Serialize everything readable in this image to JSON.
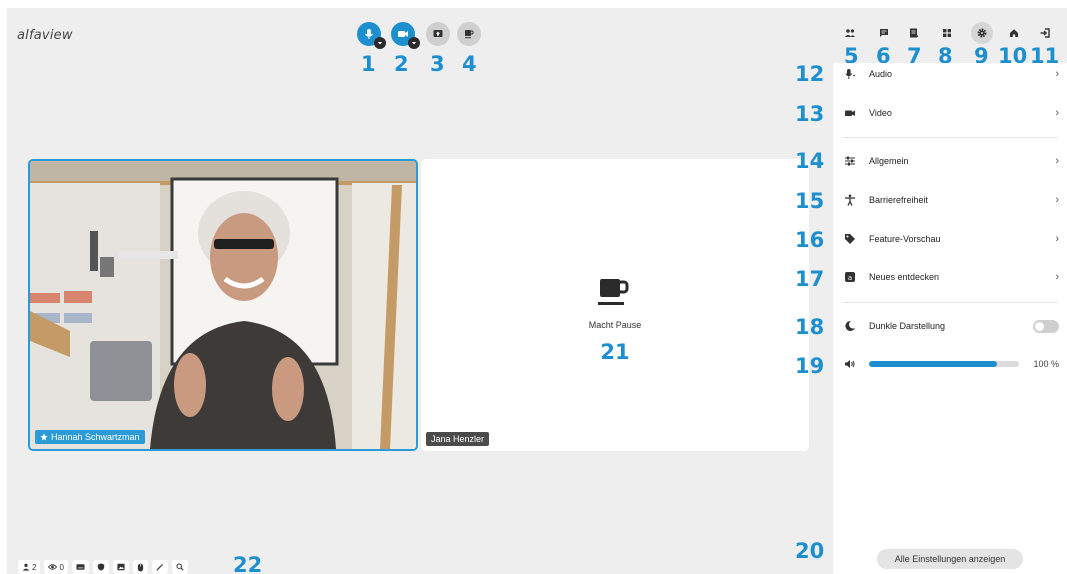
{
  "app": {
    "logo": "alfaview"
  },
  "controls": [
    {
      "id": "mic",
      "label": "1"
    },
    {
      "id": "camera",
      "label": "2"
    },
    {
      "id": "share",
      "label": "3"
    },
    {
      "id": "pause",
      "label": "4"
    }
  ],
  "top_icons": [
    {
      "id": "participants",
      "label": "5"
    },
    {
      "id": "chat",
      "label": "6"
    },
    {
      "id": "files",
      "label": "7"
    },
    {
      "id": "layout",
      "label": "8"
    },
    {
      "id": "settings",
      "label": "9"
    },
    {
      "id": "home",
      "label": "10"
    },
    {
      "id": "leave",
      "label": "11"
    }
  ],
  "video": {
    "tile1_name": "Hannah Schwartzman",
    "tile2_name": "Jana Henzler",
    "pause_text": "Macht Pause",
    "pause_marker": "21"
  },
  "settings": {
    "items": [
      {
        "marker": "12",
        "label": "Audio"
      },
      {
        "marker": "13",
        "label": "Video"
      },
      {
        "marker": "14",
        "label": "Allgemein"
      },
      {
        "marker": "15",
        "label": "Barrierefreiheit"
      },
      {
        "marker": "16",
        "label": "Feature-Vorschau"
      },
      {
        "marker": "17",
        "label": "Neues entdecken"
      }
    ],
    "dark_mode": {
      "marker": "18",
      "label": "Dunkle Darstellung",
      "enabled": false
    },
    "volume": {
      "marker": "19",
      "value": 0.85,
      "label": "100 %"
    },
    "all_settings": {
      "marker": "20",
      "label": "Alle Einstellungen anzeigen"
    }
  },
  "statusbar": {
    "participants_count": "2",
    "viewers_count": "0",
    "marker": "22"
  },
  "colors": {
    "accent": "#1d8fcf",
    "background": "#eeeeee",
    "panel": "#ffffff"
  }
}
